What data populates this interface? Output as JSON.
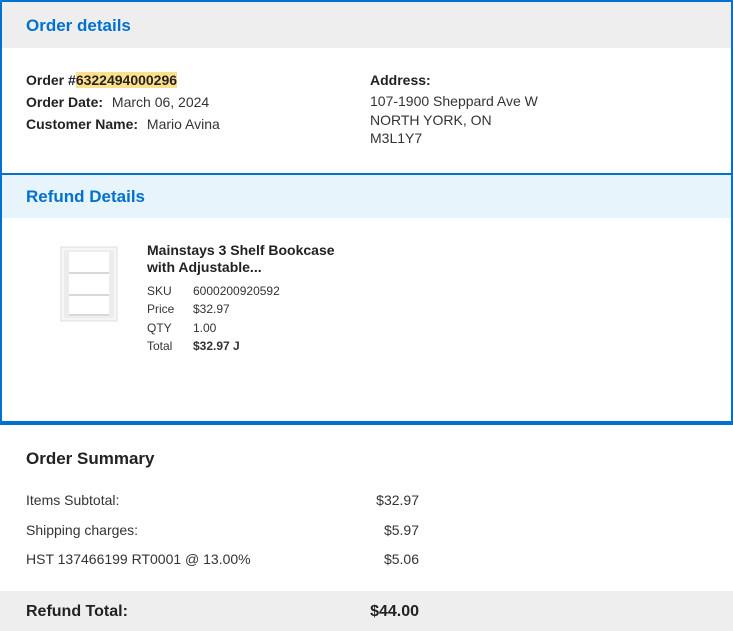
{
  "order_details": {
    "title": "Order details",
    "order_label": "Order #",
    "order_number": "6322494000296",
    "order_date_label": "Order Date:",
    "order_date": "March 06, 2024",
    "customer_name_label": "Customer Name:",
    "customer_name": "Mario Avina",
    "address_label": "Address:",
    "address_lines": [
      "107-1900 Sheppard Ave W",
      "NORTH YORK, ON",
      "M3L1Y7"
    ]
  },
  "refund_details": {
    "title": "Refund Details",
    "item": {
      "name_line1": "Mainstays 3 Shelf Bookcase",
      "name_line2": "with Adjustable...",
      "image_icon": "bookcase-image",
      "sku_label": "SKU",
      "sku": "6000200920592",
      "price_label": "Price",
      "price": "$32.97",
      "qty_label": "QTY",
      "qty": "1.00",
      "total_label": "Total",
      "total": "$32.97 J"
    }
  },
  "order_summary": {
    "title": "Order Summary",
    "lines": [
      {
        "label": "Items Subtotal:",
        "value": "$32.97"
      },
      {
        "label": "Shipping charges:",
        "value": "$5.97"
      },
      {
        "label": "HST 137466199 RT0001 @ 13.00%",
        "value": "$5.06"
      }
    ],
    "refund_total_label": "Refund Total:",
    "refund_total": "$44.00"
  },
  "colors": {
    "accent": "#0071ce",
    "header_gray": "#eeeeee",
    "header_light_blue": "#e8f4fb",
    "highlight": "#ffe08a"
  }
}
